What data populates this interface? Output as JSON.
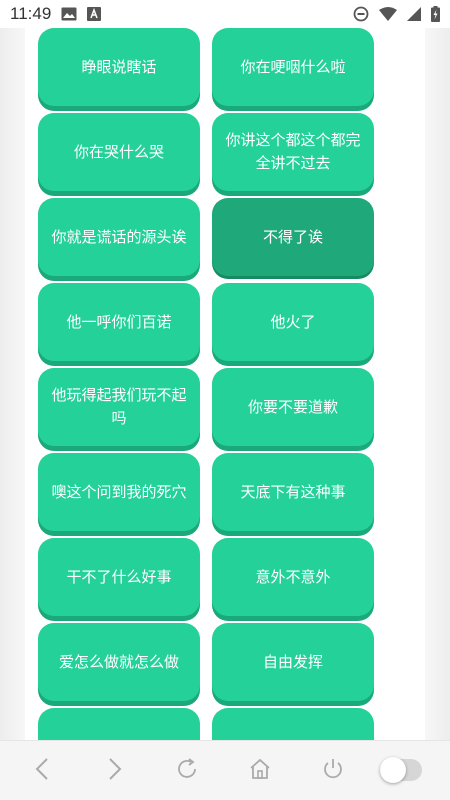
{
  "status_bar": {
    "time": "11:49",
    "icons": [
      "image-icon",
      "a-box-icon",
      "do-not-disturb-icon",
      "wifi-icon",
      "signal-icon",
      "battery-charging-icon"
    ]
  },
  "phrases": [
    {
      "label": ""
    },
    {
      "label": ""
    },
    {
      "label": "睁眼说瞎话"
    },
    {
      "label": "你在哽咽什么啦"
    },
    {
      "label": "你在哭什么哭"
    },
    {
      "label": "你讲这个都这个都完全讲不过去"
    },
    {
      "label": "你就是谎话的源头诶"
    },
    {
      "label": "不得了诶",
      "active": true
    },
    {
      "label": "他一呼你们百诺"
    },
    {
      "label": "他火了"
    },
    {
      "label": "他玩得起我们玩不起吗"
    },
    {
      "label": "你要不要道歉"
    },
    {
      "label": "噢这个问到我的死穴"
    },
    {
      "label": "天底下有这种事"
    },
    {
      "label": "干不了什么好事"
    },
    {
      "label": "意外不意外"
    },
    {
      "label": "爱怎么做就怎么做"
    },
    {
      "label": "自由发挥"
    },
    {
      "label": ""
    },
    {
      "label": ""
    }
  ],
  "colors": {
    "button": "#24d199",
    "button_shadow": "#1ba87a",
    "button_active": "#1fa97a"
  },
  "nav_bar": {
    "icons": [
      "back-icon",
      "forward-icon",
      "refresh-icon",
      "home-icon",
      "power-icon",
      "toggle-switch"
    ]
  }
}
